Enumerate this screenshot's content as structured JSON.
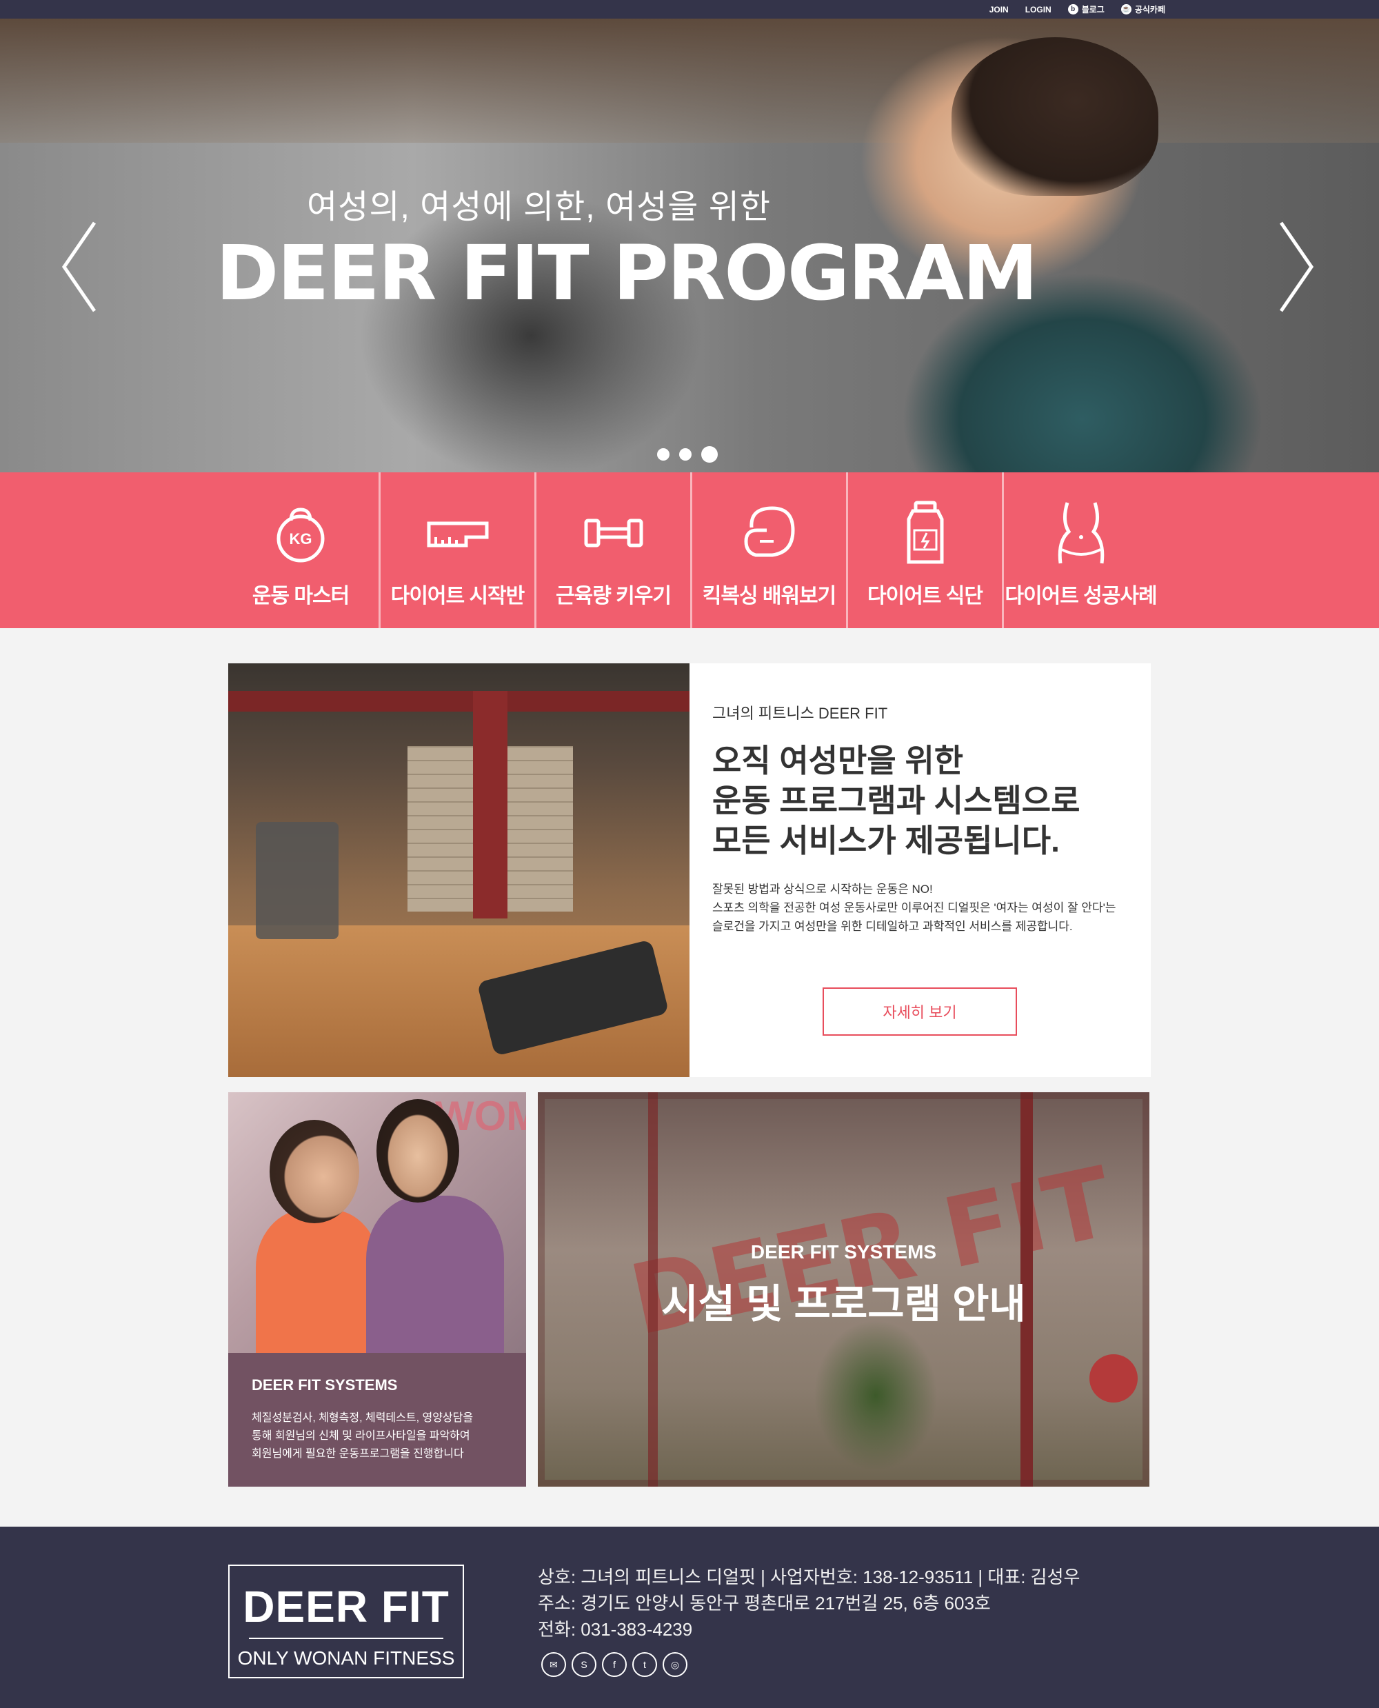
{
  "topbar": {
    "join": "JOIN",
    "login": "LOGIN",
    "blog": "블로그",
    "cafe": "공식카페"
  },
  "hero": {
    "subtitle": "여성의, 여성에 의한, 여성을 위한",
    "title": "DEER FIT PROGRAM",
    "slide_count": 3,
    "active_slide": 3
  },
  "menu": {
    "items": [
      {
        "label": "운동 마스터",
        "icon": "kettlebell-icon"
      },
      {
        "label": "다이어트 시작반",
        "icon": "tape-measure-icon"
      },
      {
        "label": "근육량 키우기",
        "icon": "dumbbell-icon"
      },
      {
        "label": "킥복싱 배워보기",
        "icon": "boxing-glove-icon"
      },
      {
        "label": "다이어트 식단",
        "icon": "supplement-bottle-icon"
      },
      {
        "label": "다이어트 성공사례",
        "icon": "waist-icon"
      }
    ],
    "colors": {
      "background": "#f15e6e"
    }
  },
  "intro": {
    "eyebrow": "그녀의 피트니스 DEER FIT",
    "headline_1": "오직 여성만을 위한",
    "headline_2": "운동 프로그램과 시스템으로",
    "headline_3": "모든 서비스가 제공됩니다.",
    "desc_1": "잘못된 방법과 상식으로 시작하는 운동은 NO!",
    "desc_2": "스포츠 의학을 전공한 여성 운동사로만 이루어진 디얼핏은 '여자는 여성이 잘 안다'는",
    "desc_3": "슬로건을 가지고 여성만을 위한 디테일하고 과학적인 서비스를 제공합니다.",
    "more_button": "자세히 보기"
  },
  "systems_card": {
    "photo_text": "WOMA",
    "title": "DEER FIT SYSTEMS",
    "desc_1": "체질성분검사, 체형측정, 체력테스트, 영양상담을",
    "desc_2": "통해 회원님의 신체 및 라이프사타일을 파악하여",
    "desc_3": "회원님에게 필요한 운동프로그램을 진행합니다"
  },
  "facility_banner": {
    "background_text": "DEER FIT",
    "subtitle": "DEER FIT SYSTEMS",
    "title": "시설 및 프로그램 안내"
  },
  "footer": {
    "logo_title": "DEER FIT",
    "logo_sub": "ONLY WONAN FITNESS",
    "line_1": "상호: 그녀의 피트니스 디얼핏 | 사업자번호: 138-12-93511 | 대표: 김성우",
    "line_2": "주소: 경기도 안양시 동안구 평촌대로 217번길 25, 6층 603호",
    "line_3": "전화: 031-383-4239",
    "sns": [
      {
        "icon": "mail-icon",
        "glyph": "✉"
      },
      {
        "icon": "skype-icon",
        "glyph": "S"
      },
      {
        "icon": "facebook-icon",
        "glyph": "f"
      },
      {
        "icon": "twitter-icon",
        "glyph": "t"
      },
      {
        "icon": "instagram-icon",
        "glyph": "◎"
      }
    ]
  },
  "colors": {
    "dark_navy": "#34344a",
    "pink": "#f15e6e",
    "plum": "#725262",
    "accent_red": "#e84d5c"
  }
}
